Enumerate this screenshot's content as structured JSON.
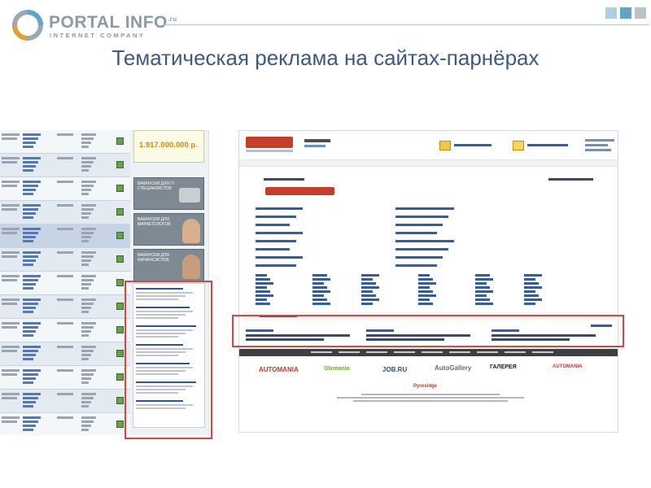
{
  "header": {
    "logo_name": "PORTAL INFO",
    "logo_suffix": ".ru",
    "logo_tagline": "INTERNET COMPANY",
    "title": "Тематическая реклама на сайтах-парнёрах",
    "squares": [
      "#aecfe0",
      "#5fa4cd",
      "#b8c2c9"
    ]
  },
  "left_screenshot": {
    "big_number": "1.917.000.000 р."
  },
  "right_screenshot": {
    "partners": [
      "AUTOMANIA",
      "Olxmania",
      "JOB.RU",
      "AutoGallery",
      "ГАЛЕРЕЯ",
      "Pyrosidge",
      "AUTOMANIA"
    ]
  }
}
